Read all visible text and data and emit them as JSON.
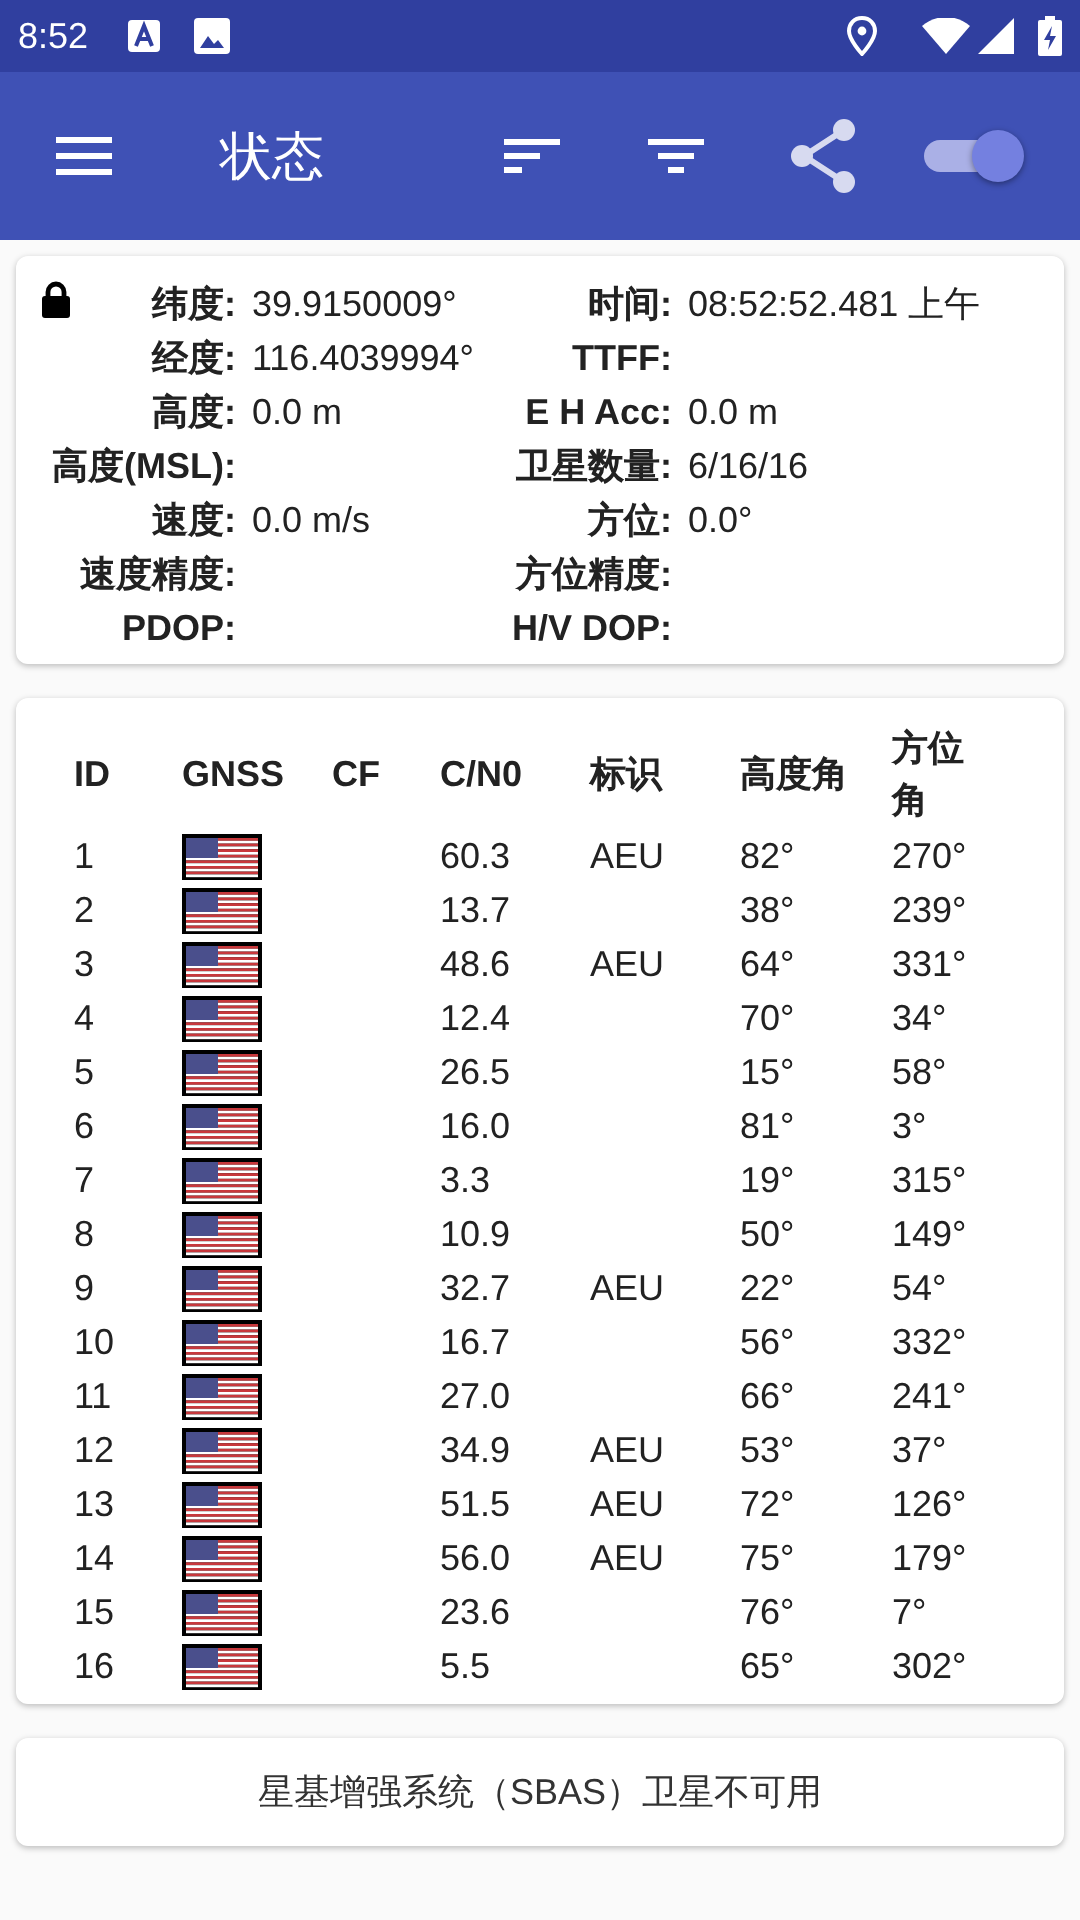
{
  "status_bar": {
    "time": "8:52"
  },
  "toolbar": {
    "title": "状态",
    "toggle_on": true
  },
  "info": [
    {
      "left": {
        "label": "纬度:",
        "value": "39.9150009°"
      },
      "right": {
        "label": "时间:",
        "value": "08:52:52.481 上午"
      }
    },
    {
      "left": {
        "label": "经度:",
        "value": "116.4039994°"
      },
      "right": {
        "label": "TTFF:"
      }
    },
    {
      "left": {
        "label": "高度:",
        "value": "0.0 m"
      },
      "right": {
        "label": "E H Acc:",
        "value": "0.0 m"
      }
    },
    {
      "left": {
        "label": "高度(MSL):"
      },
      "right": {
        "label": "卫星数量:",
        "value": "6/16/16"
      }
    },
    {
      "left": {
        "label": "速度:",
        "value": "0.0 m/s"
      },
      "right": {
        "label": "方位:",
        "value": "0.0°"
      }
    },
    {
      "left": {
        "label": "速度精度:"
      },
      "right": {
        "label": "方位精度:"
      }
    },
    {
      "left": {
        "label": "PDOP:"
      },
      "right": {
        "label": "H/V DOP:"
      }
    }
  ],
  "table": {
    "columns": [
      "ID",
      "GNSS",
      "CF",
      "C/N0",
      "标识",
      "高度角",
      "方位角"
    ],
    "rows": [
      [
        "1",
        "",
        "",
        "60.3",
        "AEU",
        "82°",
        "270°"
      ],
      [
        "2",
        "",
        "",
        "13.7",
        "",
        "38°",
        "239°"
      ],
      [
        "3",
        "",
        "",
        "48.6",
        "AEU",
        "64°",
        "331°"
      ],
      [
        "4",
        "",
        "",
        "12.4",
        "",
        "70°",
        "34°"
      ],
      [
        "5",
        "",
        "",
        "26.5",
        "",
        "15°",
        "58°"
      ],
      [
        "6",
        "",
        "",
        "16.0",
        "",
        "81°",
        "3°"
      ],
      [
        "7",
        "",
        "",
        "3.3",
        "",
        "19°",
        "315°"
      ],
      [
        "8",
        "",
        "",
        "10.9",
        "",
        "50°",
        "149°"
      ],
      [
        "9",
        "",
        "",
        "32.7",
        "AEU",
        "22°",
        "54°"
      ],
      [
        "10",
        "",
        "",
        "16.7",
        "",
        "56°",
        "332°"
      ],
      [
        "11",
        "",
        "",
        "27.0",
        "",
        "66°",
        "241°"
      ],
      [
        "12",
        "",
        "",
        "34.9",
        "AEU",
        "53°",
        "37°"
      ],
      [
        "13",
        "",
        "",
        "51.5",
        "AEU",
        "72°",
        "126°"
      ],
      [
        "14",
        "",
        "",
        "56.0",
        "AEU",
        "75°",
        "179°"
      ],
      [
        "15",
        "",
        "",
        "23.6",
        "",
        "76°",
        "7°"
      ],
      [
        "16",
        "",
        "",
        "5.5",
        "",
        "65°",
        "302°"
      ]
    ]
  },
  "sbas_message": "星基增强系统（SBAS）卫星不可用"
}
